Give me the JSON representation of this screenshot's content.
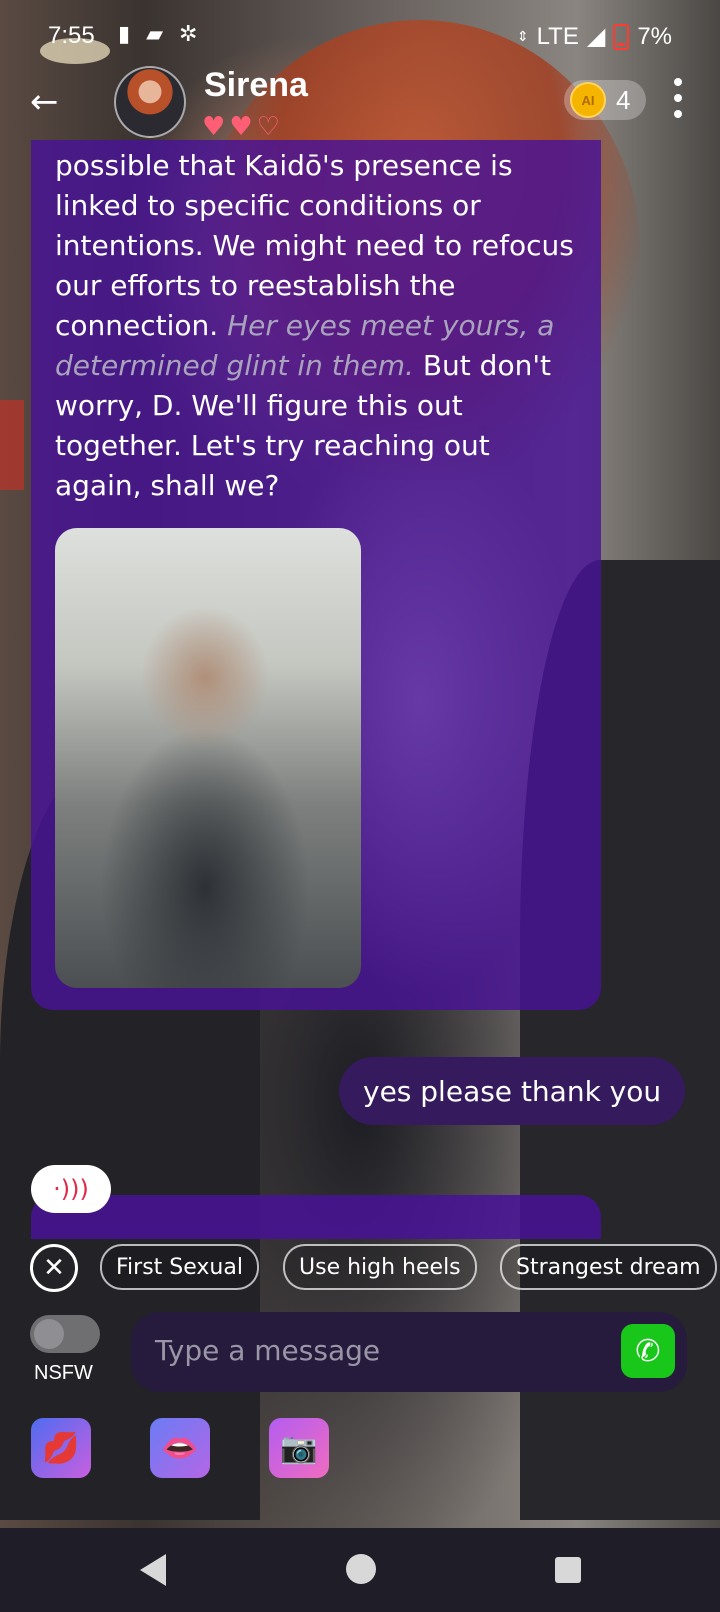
{
  "status_bar": {
    "time": "7:55",
    "network": "LTE",
    "battery": "7%",
    "icons": [
      "battery-icon",
      "data-icon",
      "app-icon"
    ]
  },
  "header": {
    "character_name": "Sirena",
    "hearts_filled": 2,
    "hearts_total": 3,
    "coin_label": "AI",
    "coin_count": "4"
  },
  "chat": {
    "bot_message_plain": "possible that Kaidō's presence is linked to specific conditions or intentions. We might need to refocus our efforts to reestablish the connection.",
    "bot_message_italic": "Her eyes meet yours, a determined glint in them.",
    "bot_message_tail": "But don't worry, D. We'll figure this out together. Let's try reaching out again, shall we?",
    "user_message": "yes please thank you"
  },
  "suggestions": [
    "First Sexual",
    "Use high heels",
    "Strangest dream"
  ],
  "composer": {
    "toggle_label": "NSFW",
    "toggle_on": false,
    "placeholder": "Type a message"
  },
  "feature_icons": [
    "kiss-icon",
    "lips-icon",
    "camera-icon"
  ],
  "colors": {
    "bubble": "#48129a",
    "user_bubble": "#351a5e",
    "call_button": "#18c71a",
    "heart": "#ff5f74"
  }
}
